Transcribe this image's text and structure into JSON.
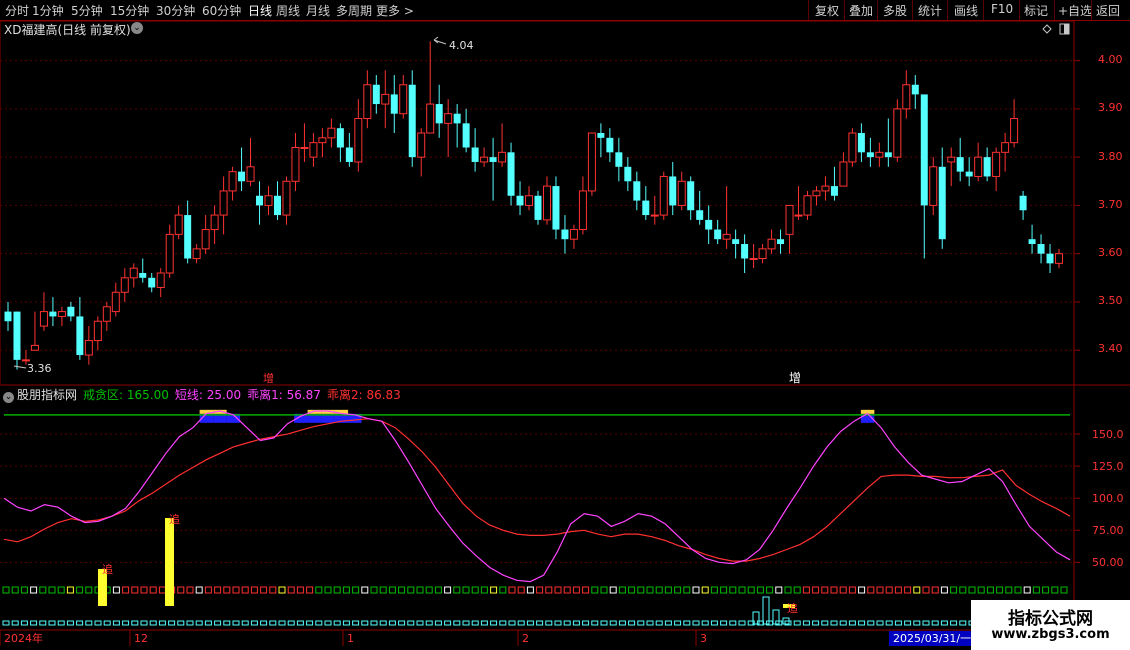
{
  "toolbar": {
    "periods": [
      "分时",
      "1分钟",
      "5分钟",
      "15分钟",
      "30分钟",
      "60分钟",
      "日线",
      "周线",
      "月线",
      "多周期",
      "更多 >"
    ],
    "active_period": "日线",
    "right_buttons": [
      "复权",
      "叠加",
      "多股",
      "统计",
      "画线",
      "F10",
      "标记",
      "+自选",
      "返回"
    ]
  },
  "stock": {
    "title": "XD福建高(日线 前复权)"
  },
  "price_axis": {
    "labels": [
      "4.00",
      "3.90",
      "3.80",
      "3.70",
      "3.60",
      "3.50",
      "3.40"
    ]
  },
  "price_markers": {
    "high": "4.04",
    "low": "3.36"
  },
  "markers": {
    "zeng1": "增",
    "zeng2": "增"
  },
  "indicator": {
    "name": "股朋指标网",
    "warn_zone": "戒贪区: 165.00",
    "short_line": "短线: 25.00",
    "deviation1": "乖离1: 56.87",
    "deviation2": "乖离2: 86.83",
    "axis_labels": [
      "150.0",
      "125.0",
      "100.0",
      "75.00",
      "50.00"
    ],
    "signal": "追",
    "colors": {
      "warn_line": "#00b000",
      "short": "#ff44ff",
      "dev1": "#ff3030",
      "dev2": "#ff3030"
    }
  },
  "time_axis": {
    "labels": [
      "2024年",
      "12",
      "1",
      "2",
      "3"
    ],
    "current_date": "2025/03/31/一"
  },
  "watermark": {
    "line1": "指标公式网",
    "line2": "www.zbgs3.com"
  },
  "colors": {
    "up": "#ff3232",
    "down": "#54ffff",
    "grid": "#5a0000",
    "axis": "#8b0000"
  },
  "chart_data": [
    {
      "type": "candlestick",
      "title": "XD福建高(日线 前复权)",
      "ylim": [
        3.33,
        4.08
      ],
      "annotations": [
        "4.04",
        "3.36"
      ],
      "candles_ohlc": [
        [
          3.48,
          3.5,
          3.46,
          3.44
        ],
        [
          3.48,
          3.48,
          3.38,
          3.36
        ],
        [
          3.38,
          3.4,
          3.38,
          3.37
        ],
        [
          3.4,
          3.48,
          3.41,
          3.4
        ],
        [
          3.45,
          3.52,
          3.48,
          3.44
        ],
        [
          3.48,
          3.51,
          3.47,
          3.45
        ],
        [
          3.47,
          3.49,
          3.48,
          3.45
        ],
        [
          3.49,
          3.5,
          3.47,
          3.46
        ],
        [
          3.47,
          3.51,
          3.39,
          3.38
        ],
        [
          3.39,
          3.45,
          3.42,
          3.37
        ],
        [
          3.42,
          3.47,
          3.46,
          3.4
        ],
        [
          3.46,
          3.5,
          3.49,
          3.44
        ],
        [
          3.48,
          3.54,
          3.52,
          3.47
        ],
        [
          3.52,
          3.57,
          3.55,
          3.5
        ],
        [
          3.55,
          3.58,
          3.57,
          3.53
        ],
        [
          3.56,
          3.59,
          3.55,
          3.54
        ],
        [
          3.55,
          3.56,
          3.53,
          3.52
        ],
        [
          3.53,
          3.57,
          3.56,
          3.51
        ],
        [
          3.56,
          3.66,
          3.64,
          3.55
        ],
        [
          3.64,
          3.7,
          3.68,
          3.63
        ],
        [
          3.68,
          3.71,
          3.59,
          3.58
        ],
        [
          3.59,
          3.62,
          3.61,
          3.58
        ],
        [
          3.61,
          3.68,
          3.65,
          3.6
        ],
        [
          3.65,
          3.7,
          3.68,
          3.62
        ],
        [
          3.68,
          3.76,
          3.73,
          3.64
        ],
        [
          3.73,
          3.78,
          3.77,
          3.71
        ],
        [
          3.77,
          3.82,
          3.75,
          3.73
        ],
        [
          3.75,
          3.84,
          3.78,
          3.74
        ],
        [
          3.72,
          3.75,
          3.7,
          3.66
        ],
        [
          3.7,
          3.74,
          3.72,
          3.68
        ],
        [
          3.72,
          3.75,
          3.68,
          3.67
        ],
        [
          3.68,
          3.76,
          3.75,
          3.66
        ],
        [
          3.75,
          3.85,
          3.82,
          3.73
        ],
        [
          3.82,
          3.87,
          3.82,
          3.79
        ],
        [
          3.8,
          3.85,
          3.83,
          3.78
        ],
        [
          3.83,
          3.86,
          3.84,
          3.8
        ],
        [
          3.84,
          3.88,
          3.86,
          3.82
        ],
        [
          3.86,
          3.87,
          3.82,
          3.79
        ],
        [
          3.82,
          3.85,
          3.79,
          3.78
        ],
        [
          3.79,
          3.92,
          3.88,
          3.77
        ],
        [
          3.88,
          3.98,
          3.95,
          3.86
        ],
        [
          3.95,
          3.97,
          3.91,
          3.89
        ],
        [
          3.91,
          3.98,
          3.93,
          3.86
        ],
        [
          3.93,
          3.97,
          3.89,
          3.85
        ],
        [
          3.89,
          3.97,
          3.95,
          3.88
        ],
        [
          3.95,
          3.98,
          3.8,
          3.78
        ],
        [
          3.8,
          3.86,
          3.85,
          3.76
        ],
        [
          3.85,
          4.04,
          3.91,
          3.89
        ],
        [
          3.91,
          3.95,
          3.87,
          3.84
        ],
        [
          3.87,
          3.92,
          3.89,
          3.8
        ],
        [
          3.89,
          3.91,
          3.87,
          3.82
        ],
        [
          3.87,
          3.9,
          3.82,
          3.81
        ],
        [
          3.82,
          3.86,
          3.79,
          3.77
        ],
        [
          3.79,
          3.82,
          3.8,
          3.78
        ],
        [
          3.8,
          3.84,
          3.79,
          3.71
        ],
        [
          3.79,
          3.87,
          3.81,
          3.78
        ],
        [
          3.81,
          3.83,
          3.72,
          3.7
        ],
        [
          3.72,
          3.75,
          3.7,
          3.68
        ],
        [
          3.7,
          3.74,
          3.72,
          3.69
        ],
        [
          3.72,
          3.73,
          3.67,
          3.66
        ],
        [
          3.67,
          3.76,
          3.74,
          3.66
        ],
        [
          3.74,
          3.76,
          3.65,
          3.63
        ],
        [
          3.65,
          3.68,
          3.63,
          3.6
        ],
        [
          3.63,
          3.66,
          3.65,
          3.61
        ],
        [
          3.65,
          3.76,
          3.73,
          3.64
        ],
        [
          3.73,
          3.83,
          3.85,
          3.72
        ],
        [
          3.85,
          3.87,
          3.84,
          3.8
        ],
        [
          3.84,
          3.86,
          3.81,
          3.79
        ],
        [
          3.81,
          3.84,
          3.78,
          3.75
        ],
        [
          3.78,
          3.8,
          3.75,
          3.73
        ],
        [
          3.75,
          3.77,
          3.71,
          3.69
        ],
        [
          3.71,
          3.74,
          3.68,
          3.67
        ],
        [
          3.68,
          3.72,
          3.68,
          3.66
        ],
        [
          3.68,
          3.77,
          3.76,
          3.67
        ],
        [
          3.76,
          3.79,
          3.7,
          3.68
        ],
        [
          3.7,
          3.77,
          3.75,
          3.69
        ],
        [
          3.75,
          3.76,
          3.69,
          3.67
        ],
        [
          3.69,
          3.73,
          3.67,
          3.66
        ],
        [
          3.67,
          3.7,
          3.65,
          3.62
        ],
        [
          3.65,
          3.67,
          3.63,
          3.62
        ],
        [
          3.63,
          3.74,
          3.64,
          3.61
        ],
        [
          3.63,
          3.65,
          3.62,
          3.59
        ],
        [
          3.62,
          3.64,
          3.59,
          3.56
        ],
        [
          3.59,
          3.62,
          3.59,
          3.57
        ],
        [
          3.59,
          3.62,
          3.61,
          3.58
        ],
        [
          3.61,
          3.65,
          3.63,
          3.6
        ],
        [
          3.63,
          3.65,
          3.62,
          3.6
        ],
        [
          3.64,
          3.7,
          3.7,
          3.6
        ],
        [
          3.68,
          3.74,
          3.68,
          3.67
        ],
        [
          3.68,
          3.73,
          3.72,
          3.67
        ],
        [
          3.72,
          3.74,
          3.73,
          3.7
        ],
        [
          3.73,
          3.76,
          3.74,
          3.71
        ],
        [
          3.74,
          3.78,
          3.72,
          3.71
        ],
        [
          3.74,
          3.81,
          3.79,
          3.74
        ],
        [
          3.79,
          3.86,
          3.85,
          3.78
        ],
        [
          3.85,
          3.87,
          3.81,
          3.79
        ],
        [
          3.81,
          3.84,
          3.8,
          3.78
        ],
        [
          3.8,
          3.83,
          3.81,
          3.78
        ],
        [
          3.81,
          3.88,
          3.8,
          3.78
        ],
        [
          3.8,
          3.92,
          3.9,
          3.79
        ],
        [
          3.9,
          3.98,
          3.95,
          3.88
        ],
        [
          3.95,
          3.97,
          3.93,
          3.9
        ],
        [
          3.93,
          3.91,
          3.7,
          3.59
        ],
        [
          3.7,
          3.8,
          3.78,
          3.68
        ],
        [
          3.78,
          3.82,
          3.63,
          3.61
        ],
        [
          3.79,
          3.82,
          3.8,
          3.74
        ],
        [
          3.8,
          3.84,
          3.77,
          3.75
        ],
        [
          3.77,
          3.8,
          3.76,
          3.74
        ],
        [
          3.76,
          3.83,
          3.8,
          3.75
        ],
        [
          3.8,
          3.82,
          3.76,
          3.75
        ],
        [
          3.76,
          3.82,
          3.81,
          3.73
        ],
        [
          3.81,
          3.85,
          3.83,
          3.77
        ],
        [
          3.83,
          3.92,
          3.88,
          3.82
        ],
        [
          3.72,
          3.73,
          3.69,
          3.67
        ],
        [
          3.63,
          3.66,
          3.62,
          3.6
        ],
        [
          3.62,
          3.64,
          3.6,
          3.58
        ],
        [
          3.6,
          3.62,
          3.58,
          3.56
        ],
        [
          3.58,
          3.61,
          3.6,
          3.57
        ]
      ]
    },
    {
      "type": "line",
      "title": "股朋指标网",
      "ylim": [
        30,
        175
      ],
      "series": [
        {
          "name": "戒贪区",
          "values": [
            165,
            165
          ]
        },
        {
          "name": "短线",
          "values": [
            100,
            93,
            90,
            95,
            93,
            86,
            81,
            82,
            86,
            92,
            105,
            120,
            135,
            148,
            155,
            166,
            168,
            165,
            155,
            145,
            147,
            158,
            164,
            168,
            168,
            166,
            165,
            162,
            160,
            145,
            128,
            110,
            92,
            78,
            65,
            55,
            46,
            40,
            36,
            35,
            40,
            58,
            80,
            88,
            86,
            78,
            82,
            88,
            86,
            80,
            70,
            60,
            53,
            50,
            49,
            52,
            60,
            75,
            92,
            108,
            125,
            140,
            152,
            160,
            166,
            155,
            140,
            128,
            118,
            115,
            112,
            113,
            118,
            123,
            113,
            95,
            78,
            68,
            58,
            52
          ]
        },
        {
          "name": "乖离1",
          "values": [
            68,
            66,
            70,
            76,
            81,
            84,
            82,
            83,
            86,
            90,
            98,
            104,
            111,
            118,
            124,
            130,
            135,
            140,
            143,
            146,
            148,
            150,
            153,
            156,
            158,
            160,
            161,
            162,
            160,
            155,
            146,
            136,
            124,
            110,
            96,
            86,
            79,
            75,
            72,
            71,
            71,
            72,
            74,
            75,
            72,
            70,
            72,
            72,
            70,
            67,
            63,
            60,
            56,
            53,
            51,
            51,
            53,
            56,
            60,
            64,
            70,
            78,
            88,
            98,
            108,
            117,
            118,
            118,
            117,
            117,
            116,
            116,
            117,
            118,
            122,
            110,
            103,
            97,
            92,
            86
          ]
        }
      ]
    },
    {
      "type": "bar",
      "title": "追",
      "series": [
        {
          "name": "追",
          "values": [
            36,
            82
          ]
        }
      ]
    }
  ]
}
